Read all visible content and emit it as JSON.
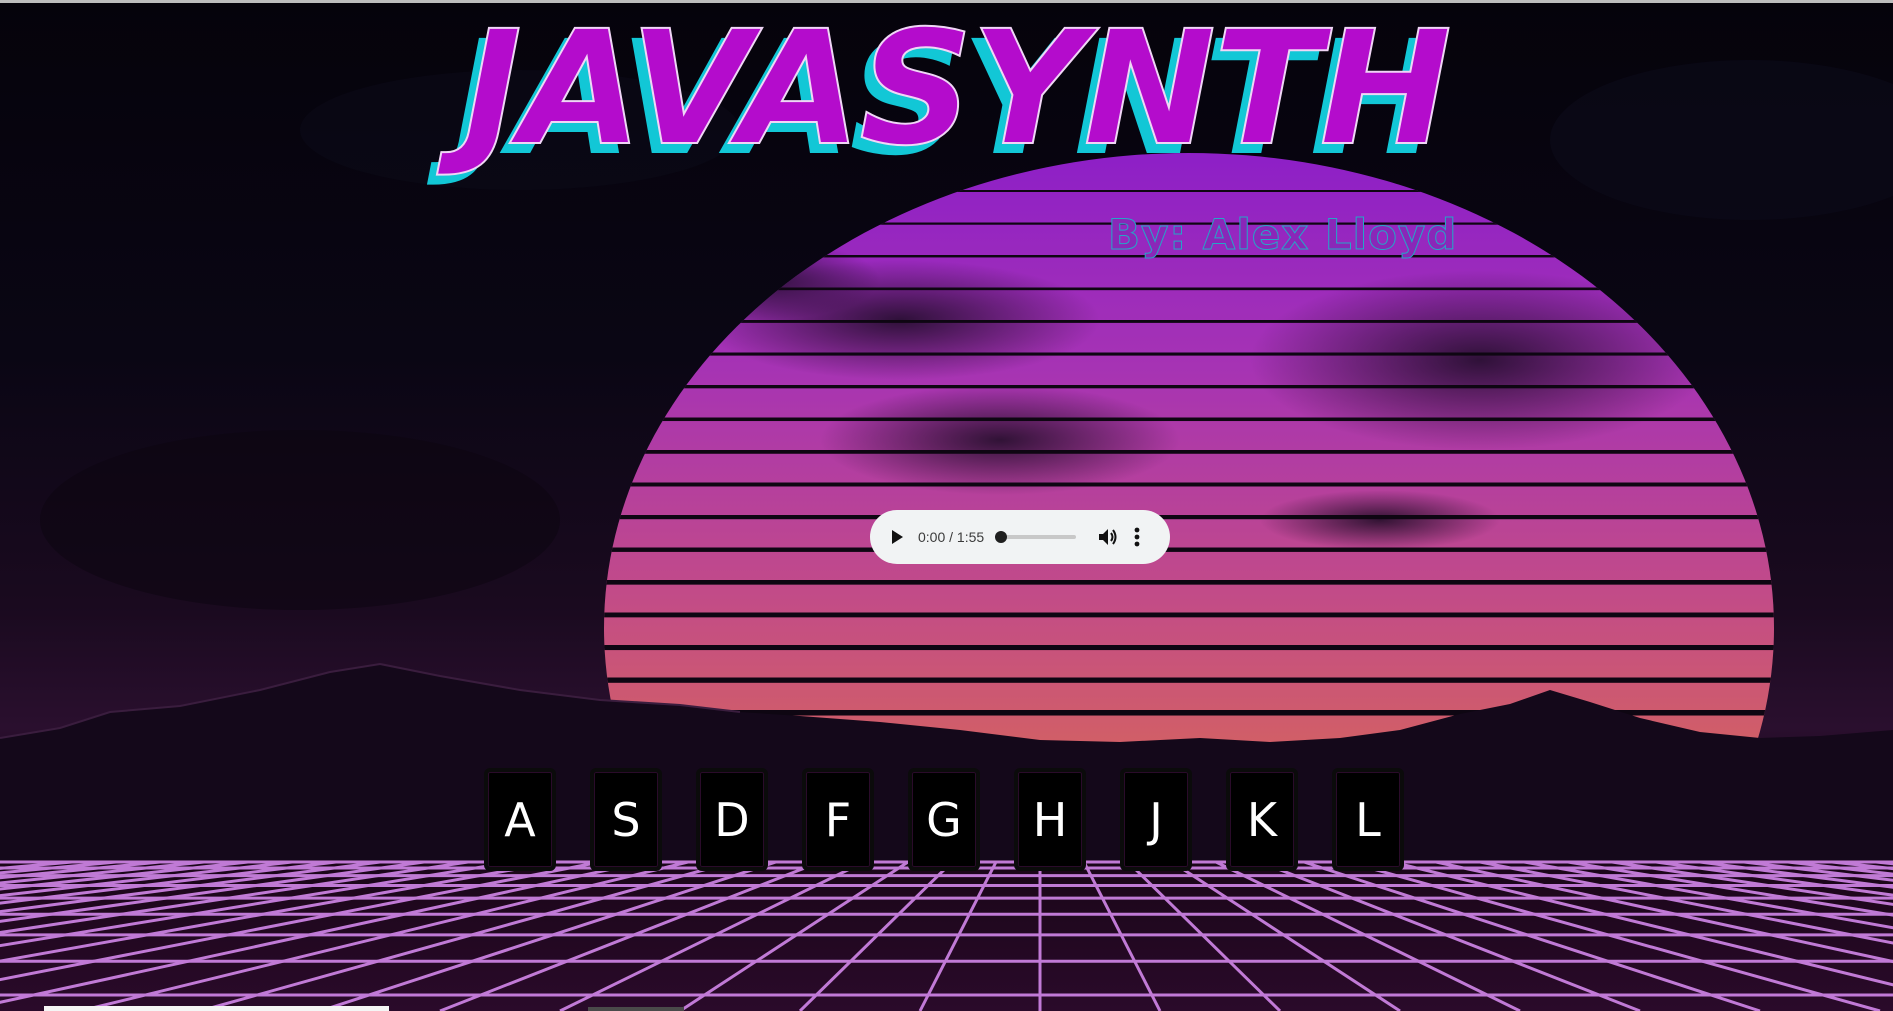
{
  "header": {
    "title": "JAVASYNTH",
    "byline": "By: Alex Lloyd"
  },
  "audio": {
    "time_display": "0:00 / 1:55",
    "progress_fraction": 0,
    "play_icon": "play-icon",
    "volume_icon": "volume-icon",
    "more_icon": "more-options-icon"
  },
  "keyboard": {
    "keys": [
      "A",
      "S",
      "D",
      "F",
      "G",
      "H",
      "J",
      "K",
      "L"
    ]
  },
  "colors": {
    "title_fill": "#b40ccc",
    "title_shadow": "#12c7d6",
    "grid_line": "#d68ae8",
    "sun_top": "#9a2bc4",
    "sun_bottom": "#cf5a66"
  }
}
